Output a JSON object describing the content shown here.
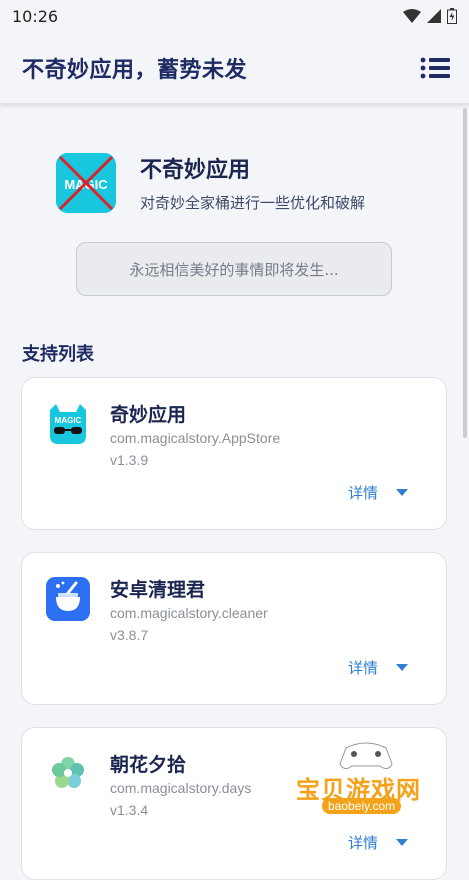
{
  "status_bar": {
    "time": "10:26",
    "icons": [
      "wifi-icon",
      "signal-icon",
      "battery-icon"
    ]
  },
  "app_bar": {
    "title": "不奇妙应用，蓄势未发",
    "menu_icon": "list-menu-icon"
  },
  "hero": {
    "logo_text": "MAGIC",
    "title": "不奇妙应用",
    "subtitle": "对奇妙全家桶进行一些优化和破解"
  },
  "motto": "永远相信美好的事情即将发生...",
  "section_title": "支持列表",
  "apps": [
    {
      "name": "奇妙应用",
      "package": "com.magicalstory.AppStore",
      "version": "v1.3.9",
      "detail_label": "详情",
      "icon": "magic-mascot-icon",
      "icon_text": "MAGIC"
    },
    {
      "name": "安卓清理君",
      "package": "com.magicalstory.cleaner",
      "version": "v3.8.7",
      "detail_label": "详情",
      "icon": "broom-cleaner-icon"
    },
    {
      "name": "朝花夕拾",
      "package": "com.magicalstory.days",
      "version": "v1.3.4",
      "detail_label": "详情",
      "icon": "flower-icon"
    }
  ],
  "watermark": {
    "text": "宝贝游戏网",
    "url": "baobeiy.com"
  },
  "colors": {
    "accent": "#2f7fd0",
    "title": "#1f2c64",
    "logo_bg": "#18c7dd",
    "cleaner_bg": "#2c6ff2"
  }
}
